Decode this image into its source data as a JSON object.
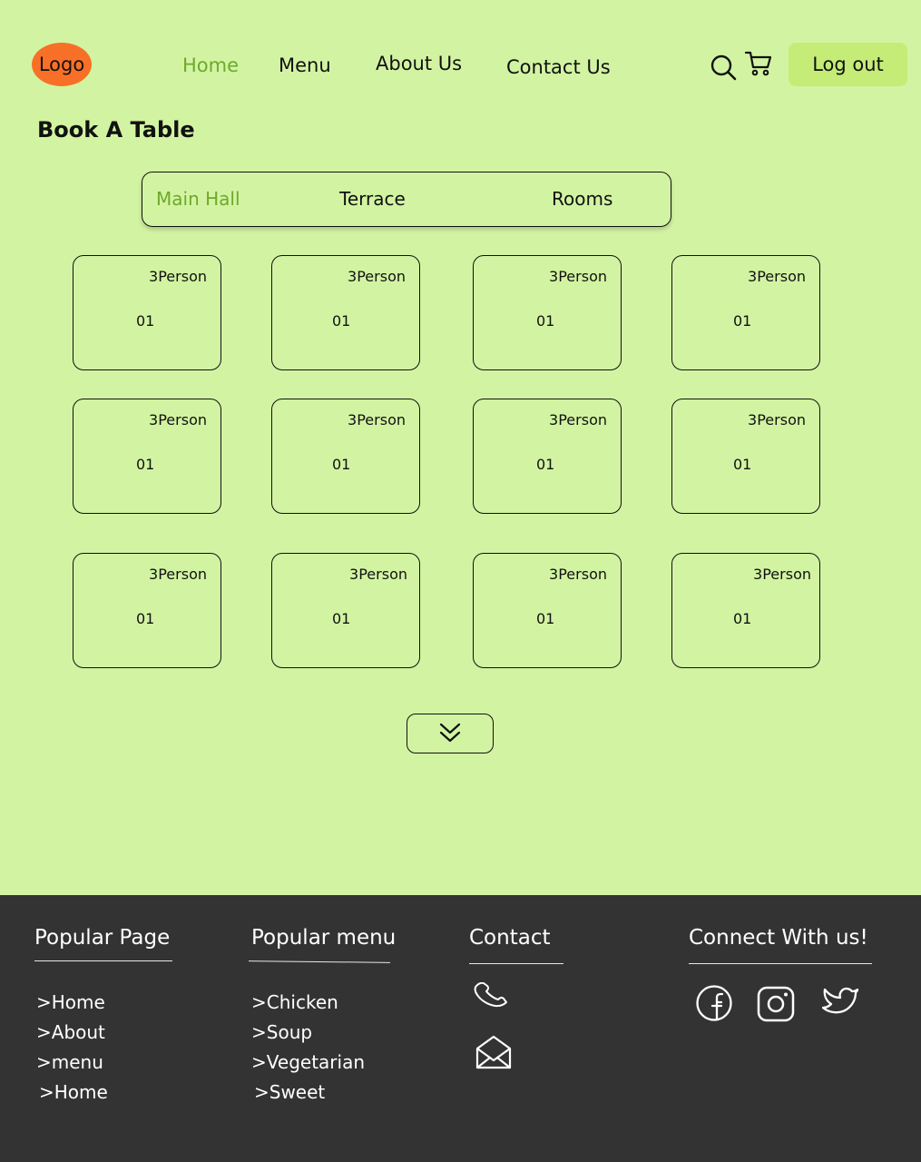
{
  "header": {
    "logo": "Logo",
    "nav": [
      {
        "label": "Home",
        "active": true
      },
      {
        "label": "Menu",
        "active": false
      },
      {
        "label": "About Us",
        "active": false
      },
      {
        "label": "Contact Us",
        "active": false
      }
    ],
    "icons": [
      "search-icon",
      "cart-icon"
    ],
    "logout_label": "Log out"
  },
  "page_title": "Book A Table",
  "tabs": [
    {
      "label": "Main Hall",
      "active": true
    },
    {
      "label": "Terrace",
      "active": false
    },
    {
      "label": "Rooms",
      "active": false
    }
  ],
  "tables": [
    {
      "capacity": "3Person",
      "number": "01"
    },
    {
      "capacity": "3Person",
      "number": "01"
    },
    {
      "capacity": "3Person",
      "number": "01"
    },
    {
      "capacity": "3Person",
      "number": "01"
    },
    {
      "capacity": "3Person",
      "number": "01"
    },
    {
      "capacity": "3Person",
      "number": "01"
    },
    {
      "capacity": "3Person",
      "number": "01"
    },
    {
      "capacity": "3Person",
      "number": "01"
    },
    {
      "capacity": "3Person",
      "number": "01"
    },
    {
      "capacity": "3Person",
      "number": "01"
    },
    {
      "capacity": "3Person",
      "number": "01"
    },
    {
      "capacity": "3Person",
      "number": "01"
    }
  ],
  "load_more_icon": "chevron-double-down-icon",
  "footer": {
    "popular_page": {
      "title": "Popular Page",
      "links": [
        ">Home",
        ">About",
        ">menu",
        ">Home"
      ]
    },
    "popular_menu": {
      "title": "Popular menu",
      "links": [
        ">Chicken",
        ">Soup",
        ">Vegetarian",
        ">Sweet"
      ]
    },
    "contact": {
      "title": "Contact",
      "icons": [
        "phone-icon",
        "mail-icon"
      ]
    },
    "connect": {
      "title": "Connect With us!",
      "icons": [
        "facebook-icon",
        "instagram-icon",
        "twitter-icon"
      ]
    }
  },
  "colors": {
    "background": "#d2f4a2",
    "accent_text": "#6fa92b",
    "logo": "#f87027",
    "logout_button": "#c5ec76",
    "footer": "#333333"
  }
}
